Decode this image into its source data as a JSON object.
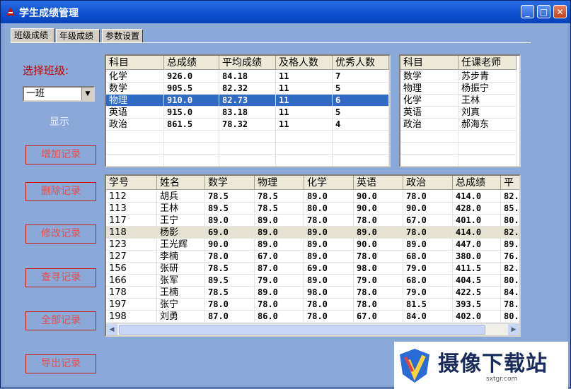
{
  "window": {
    "title": "学生成绩管理"
  },
  "tabs": [
    "班级成绩",
    "年级成绩",
    "参数设置"
  ],
  "sidebar": {
    "class_label": "选择班级:",
    "class_value": "一班",
    "show_label": "显示",
    "buttons": [
      "增加记录",
      "删除记录",
      "修改记录",
      "查寻记录",
      "全部记录",
      "导出记录"
    ]
  },
  "summary_table": {
    "headers": [
      "科目",
      "总成绩",
      "平均成绩",
      "及格人数",
      "优秀人数"
    ],
    "rows": [
      [
        "化学",
        "926.0",
        "84.18",
        "11",
        "7"
      ],
      [
        "数学",
        "905.5",
        "82.32",
        "11",
        "5"
      ],
      [
        "物理",
        "910.0",
        "82.73",
        "11",
        "6"
      ],
      [
        "英语",
        "915.0",
        "83.18",
        "11",
        "5"
      ],
      [
        "政治",
        "861.5",
        "78.32",
        "11",
        "4"
      ]
    ],
    "selected_row": 2
  },
  "teacher_table": {
    "headers": [
      "科目",
      "任课老师"
    ],
    "rows": [
      [
        "数学",
        "苏步青"
      ],
      [
        "物理",
        "杨振宁"
      ],
      [
        "化学",
        "王林"
      ],
      [
        "英语",
        "刘真"
      ],
      [
        "政治",
        "郝海东"
      ]
    ]
  },
  "student_table": {
    "headers": [
      "学号",
      "姓名",
      "数学",
      "物理",
      "化学",
      "英语",
      "政治",
      "总成绩",
      "平"
    ],
    "rows": [
      [
        "112",
        "胡兵",
        "78.5",
        "78.5",
        "89.0",
        "90.0",
        "78.0",
        "414.0",
        "82."
      ],
      [
        "113",
        "王林",
        "89.5",
        "78.5",
        "80.0",
        "90.0",
        "90.0",
        "428.0",
        "85."
      ],
      [
        "117",
        "王宁",
        "89.0",
        "89.0",
        "78.0",
        "78.0",
        "67.0",
        "401.0",
        "80."
      ],
      [
        "118",
        "杨影",
        "69.0",
        "89.0",
        "89.0",
        "89.0",
        "78.0",
        "414.0",
        "82."
      ],
      [
        "123",
        "王光辉",
        "90.0",
        "89.0",
        "89.0",
        "90.0",
        "89.0",
        "447.0",
        "89."
      ],
      [
        "127",
        "李楠",
        "78.0",
        "67.0",
        "89.0",
        "78.0",
        "68.0",
        "380.0",
        "76."
      ],
      [
        "156",
        "张研",
        "78.5",
        "87.0",
        "69.0",
        "98.0",
        "79.0",
        "411.5",
        "82."
      ],
      [
        "166",
        "张军",
        "89.5",
        "79.0",
        "89.0",
        "79.0",
        "68.0",
        "404.5",
        "80."
      ],
      [
        "178",
        "王楠",
        "78.5",
        "89.0",
        "98.0",
        "78.0",
        "79.0",
        "422.5",
        "84."
      ],
      [
        "197",
        "张宁",
        "78.0",
        "78.0",
        "78.0",
        "78.0",
        "81.5",
        "393.5",
        "78."
      ],
      [
        "198",
        "刘勇",
        "87.0",
        "86.0",
        "78.0",
        "67.0",
        "84.0",
        "402.0",
        "80."
      ]
    ],
    "highlight_row": 3
  },
  "watermark": {
    "text": "摄像下载站",
    "url": "sxtgr.com"
  },
  "colors": {
    "selection": "#316ac5",
    "accent_red": "#c00000",
    "titlebar": "#0a4fd0"
  }
}
